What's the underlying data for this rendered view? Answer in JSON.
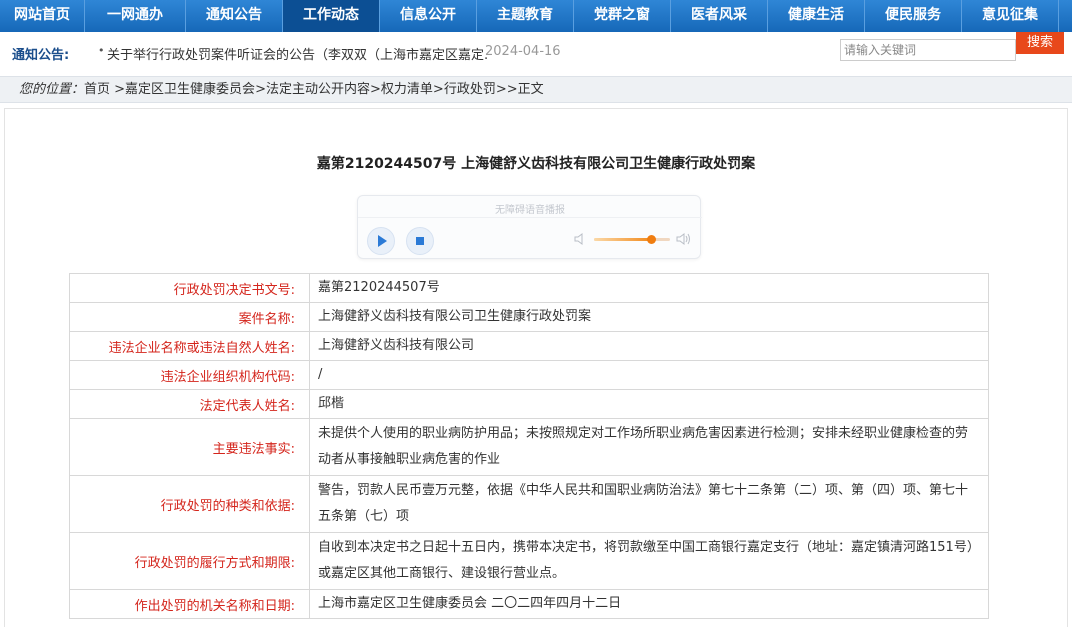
{
  "nav": {
    "items": [
      "网站首页",
      "一网通办",
      "通知公告",
      "工作动态",
      "信息公开",
      "主题教育",
      "党群之窗",
      "医者风采",
      "健康生活",
      "便民服务",
      "意见征集"
    ],
    "active_index": 3
  },
  "notice": {
    "label": "通知公告:",
    "bullet": "•",
    "text": "关于举行行政处罚案件听证会的公告（李双双（上海市嘉定区嘉定...",
    "date": "2024-04-16"
  },
  "search": {
    "placeholder": "请输入关键词",
    "button_label": "搜索"
  },
  "breadcrumb": {
    "label": "您的位置：",
    "items": [
      "首页",
      "嘉定区卫生健康委员会",
      "法定主动公开内容",
      "权力清单",
      "行政处罚",
      "正文"
    ],
    "separators": [
      " >",
      ">",
      ">",
      ">",
      ">>"
    ]
  },
  "article": {
    "title": "嘉第2120244507号 上海健舒义齿科技有限公司卫生健康行政处罚案"
  },
  "player": {
    "label": "无障碍语音播报",
    "volume_fraction": 0.75
  },
  "table": {
    "rows": [
      {
        "label": "行政处罚决定书文号:",
        "value": "嘉第2120244507号"
      },
      {
        "label": "案件名称:",
        "value": "上海健舒义齿科技有限公司卫生健康行政处罚案"
      },
      {
        "label": "违法企业名称或违法自然人姓名:",
        "value": "上海健舒义齿科技有限公司"
      },
      {
        "label": "违法企业组织机构代码:",
        "value": "/"
      },
      {
        "label": "法定代表人姓名:",
        "value": "邱楷"
      },
      {
        "label": "主要违法事实:",
        "value": "未提供个人使用的职业病防护用品；未按照规定对工作场所职业病危害因素进行检测；安排未经职业健康检查的劳动者从事接触职业病危害的作业"
      },
      {
        "label": "行政处罚的种类和依据:",
        "value": "警告，罚款人民币壹万元整，依据《中华人民共和国职业病防治法》第七十二条第（二）项、第（四）项、第七十五条第（七）项"
      },
      {
        "label": "行政处罚的履行方式和期限:",
        "value": "自收到本决定书之日起十五日内，携带本决定书，将罚款缴至中国工商银行嘉定支行（地址：嘉定镇清河路151号）或嘉定区其他工商银行、建设银行营业点。"
      },
      {
        "label": "作出处罚的机关名称和日期:",
        "value": "上海市嘉定区卫生健康委员会 二〇二四年四月十二日"
      }
    ]
  }
}
